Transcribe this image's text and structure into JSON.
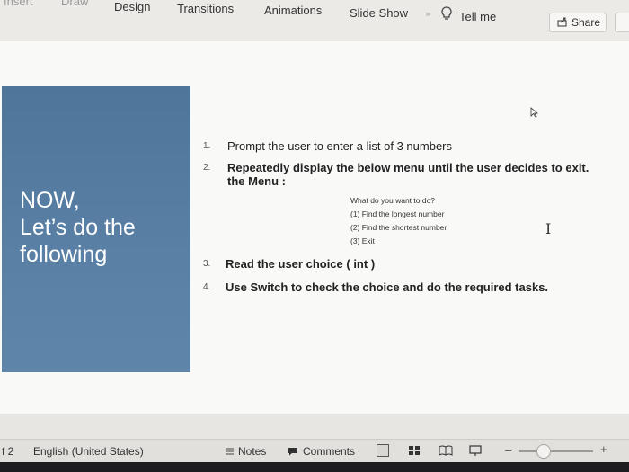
{
  "ribbon": {
    "tabs": [
      "Insert",
      "Draw",
      "Design",
      "Transitions",
      "Animations",
      "Slide Show"
    ],
    "tell_me": "Tell me",
    "share": "Share"
  },
  "slide": {
    "title_lines": [
      "NOW,",
      "Let’s do the",
      "following"
    ],
    "items": [
      {
        "number": "1.",
        "text": "Prompt the user to enter a list of 3 numbers"
      },
      {
        "number": "2.",
        "text": "Repeatedly display the below menu until the user decides to exit."
      },
      {
        "number": "3.",
        "text": "Read the user choice ( int )"
      },
      {
        "number": "4.",
        "text": "Use Switch to check the choice and do the required tasks."
      }
    ],
    "menu_label": "the Menu :",
    "menu_lines": [
      "What do you want to do?",
      "(1) Find the longest number",
      "(2) Find the shortest number",
      "(3) Exit"
    ]
  },
  "statusbar": {
    "slide_fragment": "f 2",
    "language": "English (United States)",
    "notes": "Notes",
    "comments": "Comments"
  }
}
